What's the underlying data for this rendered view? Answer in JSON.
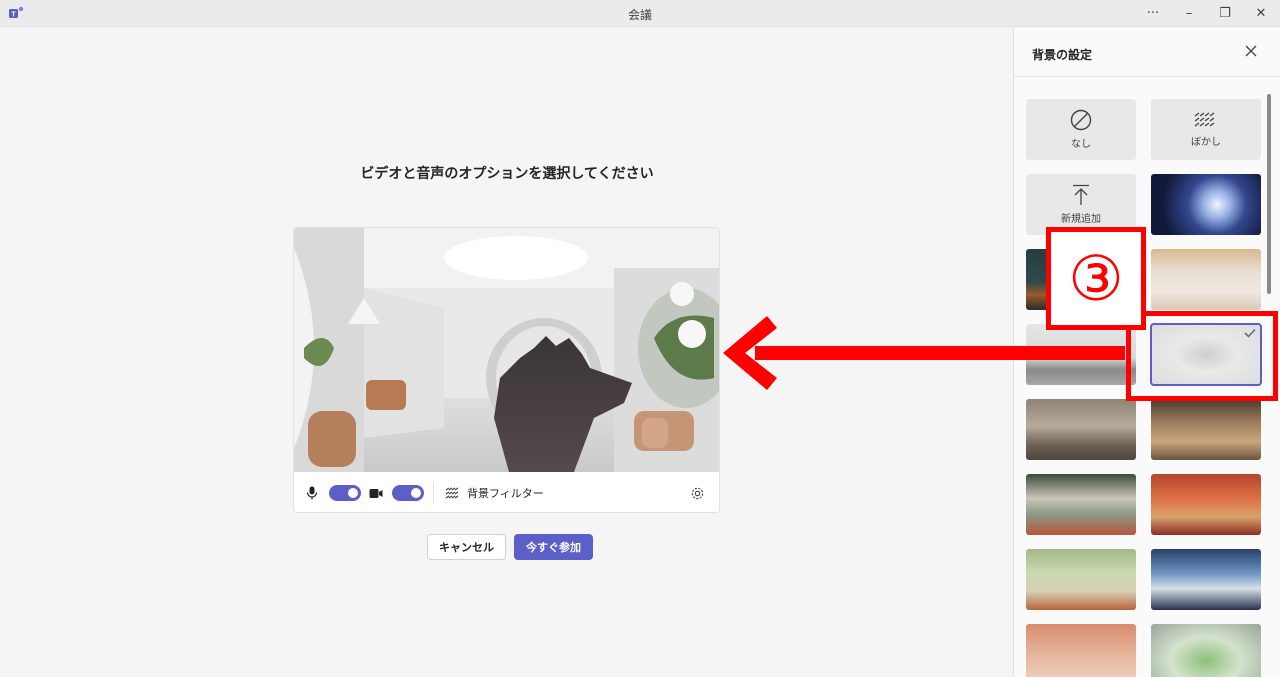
{
  "window": {
    "title": "会議",
    "more_label": "···",
    "minimize_label": "–",
    "restore_label": "❐",
    "close_label": "✕"
  },
  "main": {
    "heading": "ビデオと音声のオプションを選択してください",
    "controls": {
      "mic_on": true,
      "camera_on": true,
      "background_filter_label": "背景フィルター"
    },
    "buttons": {
      "cancel": "キャンセル",
      "join_now": "今すぐ参加"
    }
  },
  "panel": {
    "title": "背景の設定",
    "options": [
      {
        "label": "なし",
        "icon": "none-icon"
      },
      {
        "label": "ぼかし",
        "icon": "blur-icon"
      },
      {
        "label": "新規追加",
        "icon": "upload-icon"
      }
    ],
    "selected_index": 5
  },
  "annotation": {
    "badge": "③",
    "color": "#ff0000"
  },
  "colors": {
    "accent": "#5b5fc7",
    "annotation": "#ff0000"
  }
}
